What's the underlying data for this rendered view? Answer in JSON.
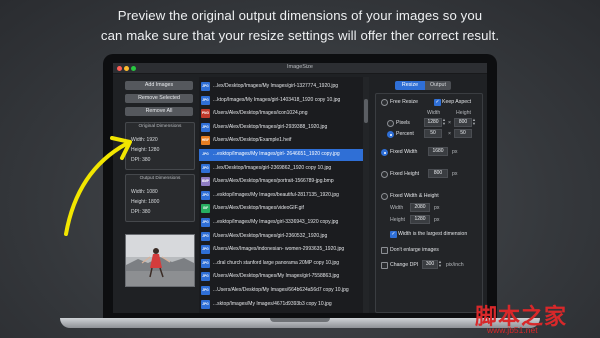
{
  "headline": {
    "line1": "Preview the original output dimensions of your images so you",
    "line2": "can make sure that your resize settings will offer ther correct result."
  },
  "window": {
    "title": "ImageSize"
  },
  "left_panel": {
    "add_images": "Add Images",
    "remove_selected": "Remove Selected",
    "remove_all": "Remove All",
    "original": {
      "title": "Original Dimensions",
      "width": "Width: 1920",
      "height": "Height: 1280",
      "dpi": "DPI: 380"
    },
    "output": {
      "title": "Output Dimensions",
      "width": "Width: 1080",
      "height": "Height: 1800",
      "dpi": "DPI: 380"
    }
  },
  "files": [
    {
      "type": "JPG",
      "color": "#2f6fd6",
      "name": "...lex/Desktop/Images/My Images/girl-1327774_1920.jpg"
    },
    {
      "type": "JPG",
      "color": "#2f6fd6",
      "name": "...ktop/Images/My Images/girl-1403418_1920 copy 10.jpg"
    },
    {
      "type": "PNG",
      "color": "#c0392b",
      "name": "/Users/Alex/Desktop/Images/icon1024.png"
    },
    {
      "type": "JPG",
      "color": "#2f6fd6",
      "name": "/Users/Alex/Desktop/Images/girl-2939388_1920.jpg"
    },
    {
      "type": "HEIF",
      "color": "#e67e22",
      "name": "/Users/Alex/Desktop/Example1.heif"
    },
    {
      "type": "JPG",
      "color": "#2f6fd6",
      "name": "...esktop/Images/My Images/girl- 2646651_1920 copy.jpg",
      "selected": true
    },
    {
      "type": "JPG",
      "color": "#2f6fd6",
      "name": "...lex/Desktop/Images/girl-2369862_1920 copy 10.jpg"
    },
    {
      "type": "BMP",
      "color": "#8e7cc3",
      "name": "/Users/Alex/Desktop/Images/portrait-1566789-jpg.bmp"
    },
    {
      "type": "JPG",
      "color": "#2f6fd6",
      "name": "...esktop/Images/My Images/beautiful-2817135_1920.jpg"
    },
    {
      "type": "GIF",
      "color": "#27ae60",
      "name": "/Users/Alex/Desktop/Images/videoGIF.gif"
    },
    {
      "type": "JPG",
      "color": "#2f6fd6",
      "name": "...esktop/Images/My Images/girl-3336943_1920 copy.jpg"
    },
    {
      "type": "JPG",
      "color": "#2f6fd6",
      "name": "/Users/Alex/Desktop/Images/girl-2360532_1920.jpg"
    },
    {
      "type": "JPG",
      "color": "#2f6fd6",
      "name": "/Users/Alex/Images/indonesian- women-2993635_1920.jpg"
    },
    {
      "type": "JPG",
      "color": "#2f6fd6",
      "name": "...dral church stanford large panorama 20MP copy 10.jpg"
    },
    {
      "type": "JPG",
      "color": "#2f6fd6",
      "name": "/Users/Alex/Desktop/Images/My Images/girl-7558863.jpg"
    },
    {
      "type": "JPG",
      "color": "#2f6fd6",
      "name": "...Users/Alex/Desktop/My Images/664b624a56d7 copy 10.jpg"
    },
    {
      "type": "JPG",
      "color": "#2f6fd6",
      "name": "...sktop/Images/My Images/4671d9393b3 copy 10.jpg"
    }
  ],
  "tabs": {
    "resize": "Resize",
    "output": "Output"
  },
  "options": {
    "free_resize": "Free Resize",
    "keep_aspect": "Keep Aspect",
    "col_width": "Width",
    "col_height": "Height",
    "pixels": "Pixels",
    "pixels_w": "1280",
    "pixels_h": "800",
    "percent": "Percent",
    "percent_w": "50",
    "percent_h": "50",
    "fixed_width": "Fixed Width",
    "fixed_width_val": "1680",
    "px": "px",
    "fixed_height": "Fixed Height",
    "fixed_height_val": "800",
    "fixed_wh": "Fixed Width & Height",
    "fwh_width_label": "Width",
    "fwh_width_val": "2080",
    "fwh_height_label": "Height",
    "fwh_height_val": "1280",
    "largest_dim": "Width is the largest dimension",
    "dont_enlarge": "Don't enlarge images",
    "change_dpi": "Change DPI",
    "dpi_val": "300",
    "pix_inch": "pix/inch"
  },
  "watermark": {
    "cn": "脚本之家",
    "url": "www.jb51.net"
  },
  "colors": {
    "accent": "#2f6fd6",
    "annotation": "#f2e600"
  }
}
